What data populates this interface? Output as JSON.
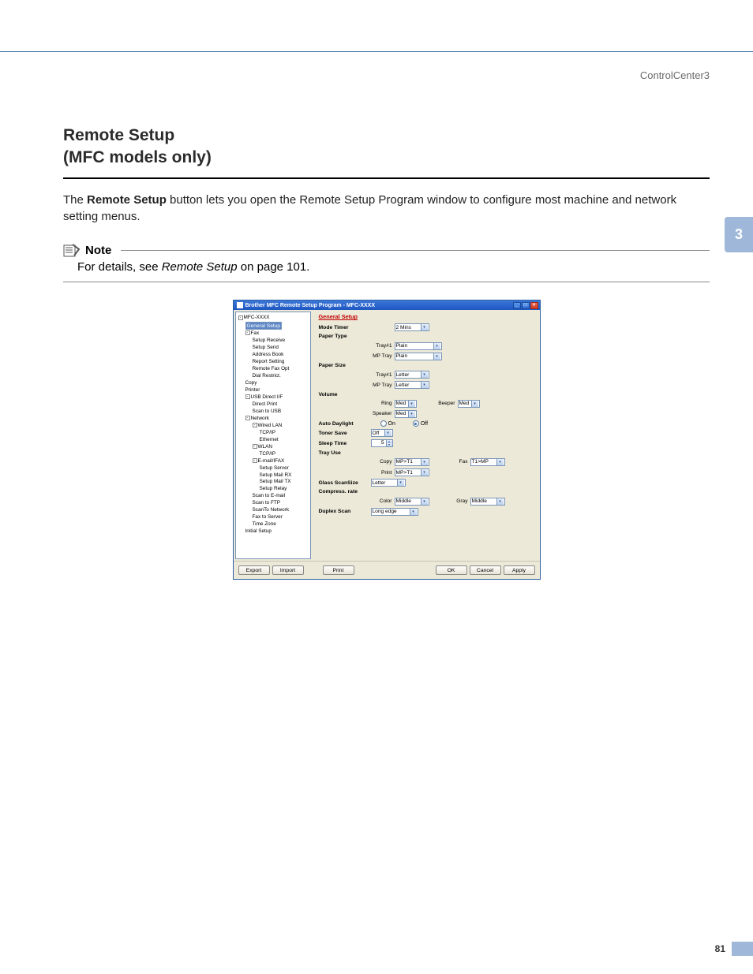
{
  "header": {
    "right": "ControlCenter3"
  },
  "heading": {
    "line1": "Remote Setup",
    "line2": "(MFC models only)"
  },
  "paragraph": {
    "pre": "The ",
    "bold": "Remote Setup",
    "post": " button lets you open the Remote Setup Program window to configure most machine and network setting menus."
  },
  "note": {
    "label": "Note",
    "pre": "For details, see ",
    "ital": "Remote Setup",
    "post": " on page 101."
  },
  "side_tab": "3",
  "page_number": "81",
  "dialog": {
    "title": "Brother MFC Remote Setup Program - MFC-XXXX",
    "tree": {
      "root": "MFC-XXXX",
      "general_setup": "General Setup",
      "fax": {
        "label": "Fax",
        "items": [
          "Setup Receive",
          "Setup Send",
          "Address Book",
          "Report Setting",
          "Remote Fax Opt",
          "Dial Restrict."
        ]
      },
      "copy": "Copy",
      "printer": "Printer",
      "usb": {
        "label": "USB Direct I/F",
        "items": [
          "Direct Print",
          "Scan to USB"
        ]
      },
      "network": {
        "label": "Network",
        "wiredlan": {
          "label": "Wired LAN",
          "items": [
            "TCP/IP",
            "Ethernet"
          ]
        },
        "wlan": {
          "label": "WLAN",
          "items": [
            "TCP/IP"
          ]
        },
        "emailifax": {
          "label": "E-mail/IFAX",
          "items": [
            "Setup Server",
            "Setup Mail RX",
            "Setup Mail TX",
            "Setup Relay"
          ]
        },
        "others": [
          "Scan to E-mail",
          "Scan to FTP",
          "ScanTo Network",
          "Fax to Server",
          "Time Zone"
        ]
      },
      "initial": "Initial Setup"
    },
    "form": {
      "title": "General Setup",
      "mode_timer": {
        "label": "Mode Timer",
        "value": "2 Mins"
      },
      "paper_type": {
        "label": "Paper Type",
        "tray1": {
          "label": "Tray#1",
          "value": "Plain"
        },
        "mp": {
          "label": "MP Tray",
          "value": "Plain"
        }
      },
      "paper_size": {
        "label": "Paper Size",
        "tray1": {
          "label": "Tray#1",
          "value": "Letter"
        },
        "mp": {
          "label": "MP Tray",
          "value": "Letter"
        }
      },
      "volume": {
        "label": "Volume",
        "ring": {
          "label": "Ring",
          "value": "Med"
        },
        "beeper": {
          "label": "Beeper",
          "value": "Med"
        },
        "speaker": {
          "label": "Speaker",
          "value": "Med"
        }
      },
      "auto_daylight": {
        "label": "Auto Daylight",
        "on": "On",
        "off": "Off",
        "selected": "off"
      },
      "toner_save": {
        "label": "Toner Save",
        "value": "Off"
      },
      "sleep_time": {
        "label": "Sleep Time",
        "value": "5"
      },
      "tray_use": {
        "label": "Tray Use",
        "copy": {
          "label": "Copy",
          "value": "MP>T1"
        },
        "fax": {
          "label": "Fax",
          "value": "T1>MP"
        },
        "print": {
          "label": "Print",
          "value": "MP>T1"
        }
      },
      "glass_scansize": {
        "label": "Glass ScanSize",
        "value": "Letter"
      },
      "compress_rate": {
        "label": "Compress. rate",
        "color": {
          "label": "Color",
          "value": "Middle"
        },
        "gray": {
          "label": "Gray",
          "value": "Middle"
        }
      },
      "duplex_scan": {
        "label": "Duplex Scan",
        "value": "Long edge"
      }
    },
    "buttons": {
      "export": "Export",
      "import": "Import",
      "print": "Print",
      "ok": "OK",
      "cancel": "Cancel",
      "apply": "Apply"
    }
  }
}
